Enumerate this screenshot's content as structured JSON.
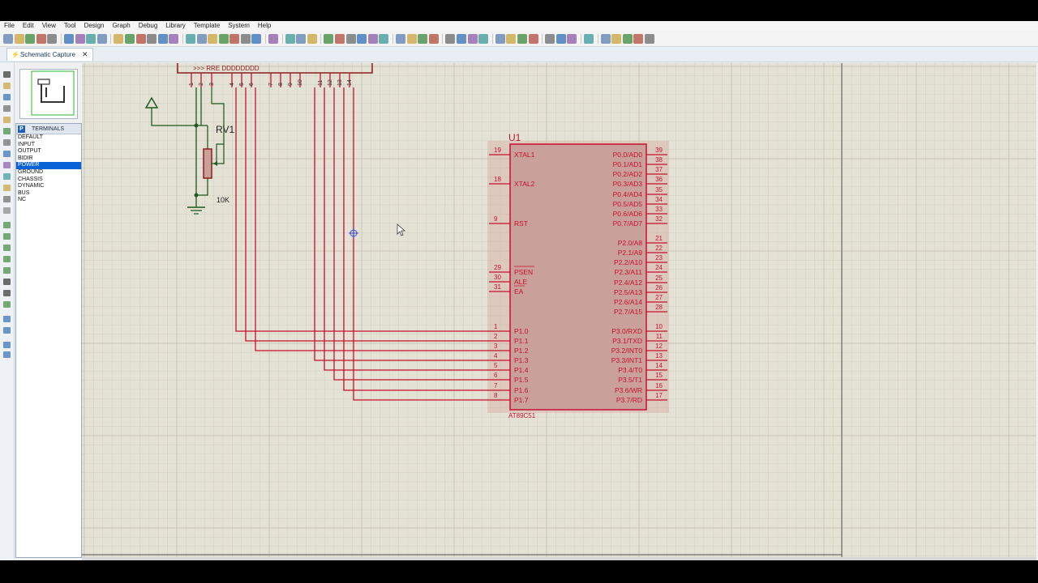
{
  "menu": [
    "File",
    "Edit",
    "View",
    "Tool",
    "Design",
    "Graph",
    "Debug",
    "Library",
    "Template",
    "System",
    "Help"
  ],
  "tab": {
    "title": "Schematic Capture",
    "close": "✕"
  },
  "terminals": {
    "header_icon": "P",
    "header": "TERMINALS",
    "items": [
      "DEFAULT",
      "INPUT",
      "OUTPUT",
      "BIDIR",
      "POWER",
      "GROUND",
      "CHASSIS",
      "DYNAMIC",
      "BUS",
      "NC"
    ],
    "selected_index": 4
  },
  "schematic": {
    "ref": "U1",
    "part": "AT89C51",
    "left_pins": [
      {
        "num": "19",
        "name": "XTAL1"
      },
      {
        "num": "18",
        "name": "XTAL2"
      },
      {
        "num": "9",
        "name": "RST"
      },
      {
        "num": "29",
        "name": "PSEN"
      },
      {
        "num": "30",
        "name": "ALE"
      },
      {
        "num": "31",
        "name": "EA"
      },
      {
        "num": "1",
        "name": "P1.0"
      },
      {
        "num": "2",
        "name": "P1.1"
      },
      {
        "num": "3",
        "name": "P1.2"
      },
      {
        "num": "4",
        "name": "P1.3"
      },
      {
        "num": "5",
        "name": "P1.4"
      },
      {
        "num": "6",
        "name": "P1.5"
      },
      {
        "num": "7",
        "name": "P1.6"
      },
      {
        "num": "8",
        "name": "P1.7"
      }
    ],
    "right_pins": [
      {
        "num": "39",
        "name": "P0.0/AD0"
      },
      {
        "num": "38",
        "name": "P0.1/AD1"
      },
      {
        "num": "37",
        "name": "P0.2/AD2"
      },
      {
        "num": "36",
        "name": "P0.3/AD3"
      },
      {
        "num": "35",
        "name": "P0.4/AD4"
      },
      {
        "num": "34",
        "name": "P0.5/AD5"
      },
      {
        "num": "33",
        "name": "P0.6/AD6"
      },
      {
        "num": "32",
        "name": "P0.7/AD7"
      },
      {
        "num": "21",
        "name": "P2.0/A8"
      },
      {
        "num": "22",
        "name": "P2.1/A9"
      },
      {
        "num": "23",
        "name": "P2.2/A10"
      },
      {
        "num": "24",
        "name": "P2.3/A11"
      },
      {
        "num": "25",
        "name": "P2.4/A12"
      },
      {
        "num": "26",
        "name": "P2.5/A13"
      },
      {
        "num": "27",
        "name": "P2.6/A14"
      },
      {
        "num": "28",
        "name": "P2.7/A15"
      },
      {
        "num": "10",
        "name": "P3.0/RXD"
      },
      {
        "num": "11",
        "name": "P3.1/TXD"
      },
      {
        "num": "12",
        "name": "P3.2/INT0"
      },
      {
        "num": "13",
        "name": "P3.3/INT1"
      },
      {
        "num": "14",
        "name": "P3.4/T0"
      },
      {
        "num": "15",
        "name": "P3.5/T1"
      },
      {
        "num": "16",
        "name": "P3.6/WR"
      },
      {
        "num": "17",
        "name": "P3.7/RD"
      }
    ],
    "lcd_header_pins": [
      "1",
      "2",
      "3",
      "4",
      "5",
      "6",
      "7",
      "8",
      "9",
      "10",
      "11",
      "12",
      "13",
      "14"
    ],
    "lcd_labels": ">>>  RRE  DDDDDDDD",
    "pot_ref": "RV1",
    "pot_value": "10K"
  },
  "colors": {
    "wire": "#c8102e",
    "chip_fill": "#c9a09a",
    "green_wire": "#1f5a1f",
    "pot_body": "#8b1c1c",
    "canvas_bg": "#e4e2d5",
    "grid": "#d2cfc1",
    "selected": "#0a63d6"
  },
  "icons": [
    "select-arrow-icon",
    "component-icon",
    "junction-dot-icon",
    "wire-label-icon",
    "text-script-icon",
    "bus-icon",
    "subcircuit-icon",
    "terminal-icon",
    "pin-icon",
    "graph-icon",
    "tape-icon",
    "generator-icon",
    "probe-icon",
    "line-icon",
    "box-icon",
    "circle-icon",
    "arc-icon",
    "path-icon",
    "text-icon",
    "symbol-icon",
    "marker-icon",
    "rotate-cw-icon",
    "rotate-ccw-icon",
    "mirror-h-icon",
    "mirror-v-icon"
  ]
}
